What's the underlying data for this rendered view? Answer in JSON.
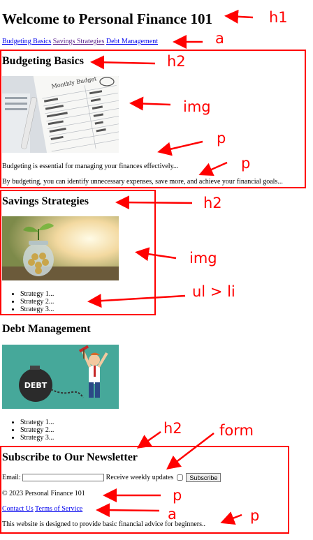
{
  "page": {
    "title": "Welcome to Personal Finance 101",
    "nav": [
      "Budgeting Basics",
      "Savings Strategies",
      "Debt Management"
    ]
  },
  "budgeting": {
    "heading": "Budgeting Basics",
    "image_text": "Monthly Budget",
    "p1": "Budgeting is essential for managing your finances effectively...",
    "p2": "By budgeting, you can identify unnecessary expenses, save more, and achieve your financial goals..."
  },
  "savings": {
    "heading": "Savings Strategies",
    "items": [
      "Strategy 1...",
      "Strategy 2...",
      "Strategy 3..."
    ]
  },
  "debt": {
    "heading": "Debt Management",
    "image_text": "DEBT",
    "items": [
      "Strategy 1...",
      "Strategy 2...",
      "Strategy 3..."
    ]
  },
  "newsletter": {
    "heading": "Subscribe to Our Newsletter",
    "email_label": "Email:",
    "checkbox_label": "Receive weekly updates",
    "submit_label": "Subscribe"
  },
  "footer": {
    "copyright": "© 2023 Personal Finance 101",
    "links": [
      "Contact Us",
      "Terms of Service"
    ],
    "disclaimer": "This website is designed to provide basic financial advice for beginners.."
  },
  "annotations": {
    "h1": "h1",
    "a_top": "a",
    "h2_budget": "h2",
    "img_budget": "img",
    "p_a": "p",
    "p_b": "p",
    "h2_savings": "h2",
    "img_savings": "img",
    "ul_li": "ul > li",
    "h2_news": "h2",
    "form": "form",
    "p_footer": "p",
    "a_footer": "a",
    "p_footer2": "p",
    "color": "#ff0000"
  }
}
